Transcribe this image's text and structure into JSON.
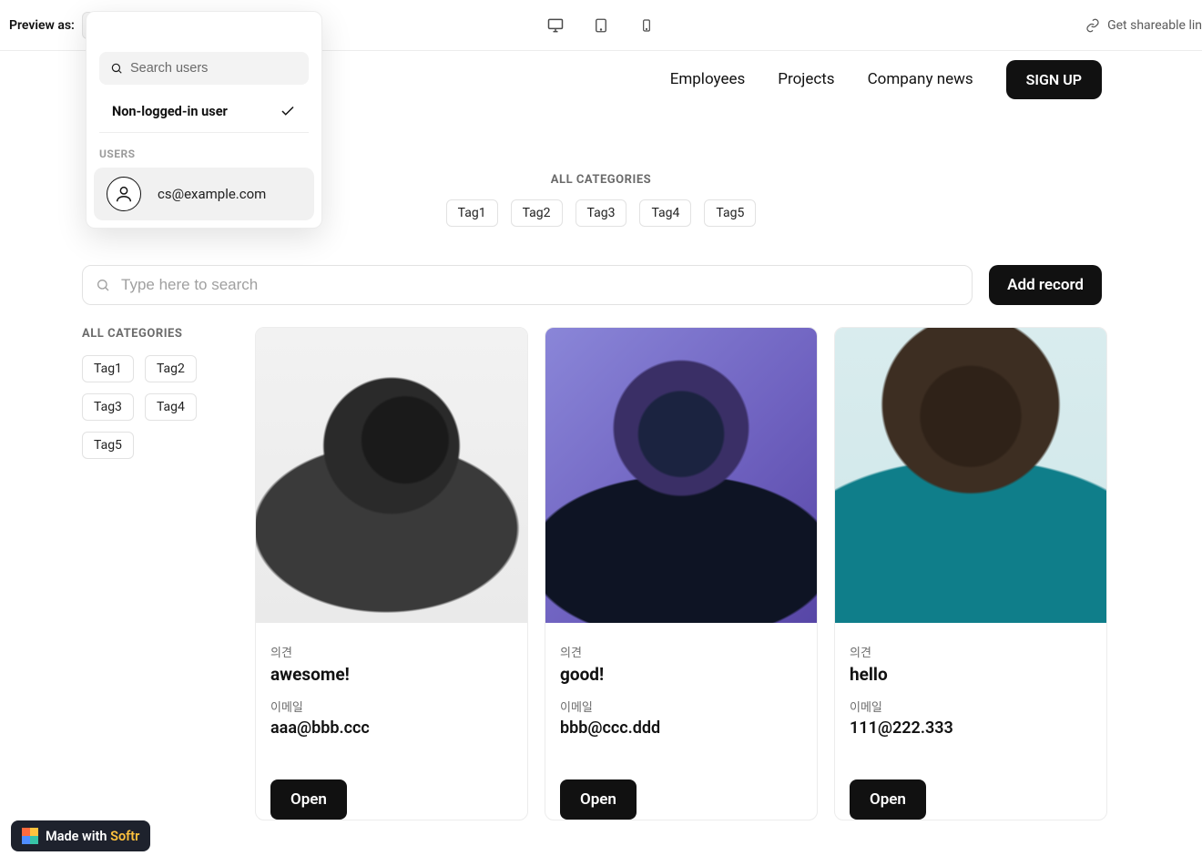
{
  "topbar": {
    "preview_label": "Preview as:",
    "selected_user": "Non-logged-in user",
    "share_link_label": "Get shareable lin"
  },
  "dropdown": {
    "search_placeholder": "Search users",
    "current_option": "Non-logged-in user",
    "section_label": "USERS",
    "users": [
      {
        "email": "cs@example.com"
      }
    ]
  },
  "nav": {
    "items": [
      "Employees",
      "Projects",
      "Company news"
    ],
    "signup_label": "SIGN UP"
  },
  "top_categories": {
    "title": "ALL CATEGORIES",
    "tags": [
      "Tag1",
      "Tag2",
      "Tag3",
      "Tag4",
      "Tag5"
    ]
  },
  "toolbar": {
    "search_placeholder": "Type here to search",
    "add_record_label": "Add record"
  },
  "sidebar_categories": {
    "title": "ALL CATEGORIES",
    "tags": [
      "Tag1",
      "Tag2",
      "Tag3",
      "Tag4",
      "Tag5"
    ]
  },
  "cards": [
    {
      "opinion_label": "의견",
      "opinion_value": "awesome!",
      "email_label": "이메일",
      "email_value": "aaa@bbb.ccc",
      "open_label": "Open"
    },
    {
      "opinion_label": "의견",
      "opinion_value": "good!",
      "email_label": "이메일",
      "email_value": "bbb@ccc.ddd",
      "open_label": "Open"
    },
    {
      "opinion_label": "의견",
      "opinion_value": "hello",
      "email_label": "이메일",
      "email_value": "111@222.333",
      "open_label": "Open"
    }
  ],
  "badge": {
    "prefix": "Made with ",
    "brand": "Softr"
  }
}
